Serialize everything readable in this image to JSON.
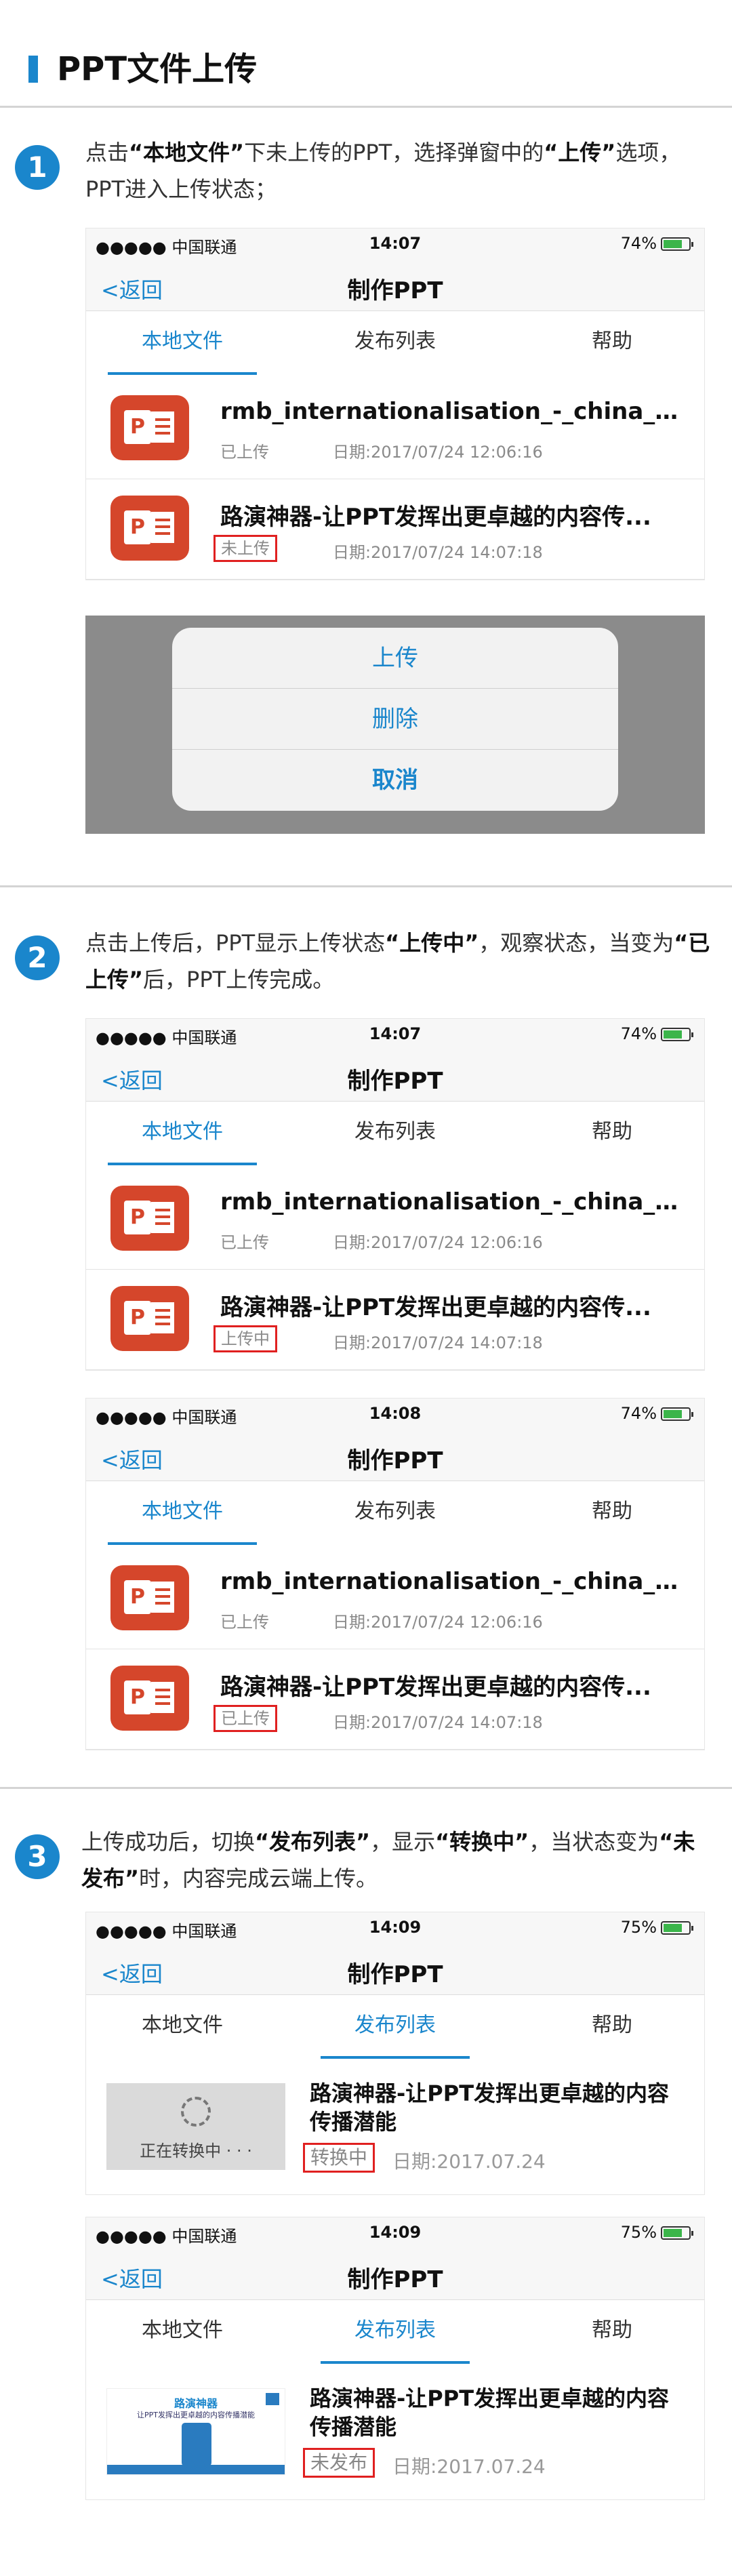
{
  "page": {
    "title": "PPT文件上传"
  },
  "steps": [
    {
      "num": "1",
      "text_parts": [
        "点击",
        "“本地文件”",
        "下未上传的PPT，选择弹窗中的",
        "“上传”",
        "选项，PPT进入上传状态；"
      ]
    },
    {
      "num": "2",
      "text_parts": [
        "点击上传后，PPT显示上传状态",
        "“上传中”",
        "，观察状态，当变为",
        "“已上传”",
        "后，PPT上传完成。"
      ]
    },
    {
      "num": "3",
      "text_parts": [
        "上传成功后，切换",
        "“发布列表”",
        "，显示",
        "“转换中”",
        "，当状态变为",
        "“未发布”",
        "时，内容完成云端上传。"
      ]
    }
  ],
  "colors": {
    "accent": "#1a86cc",
    "highlight_box": "#e02020",
    "ppt_icon": "#d5462b"
  },
  "ui": {
    "carrier": "●●●●● 中国联通",
    "back": "<返回",
    "nav_title": "制作PPT",
    "tabs": [
      "本地文件",
      "发布列表",
      "帮助"
    ]
  },
  "screens": [
    {
      "time": "14:07",
      "battery": "74%",
      "battery_level": 0.74,
      "active_tab": 0,
      "rows": [
        {
          "name": "rmb_internationalisation_-_china_webi...",
          "status": "已上传",
          "date": "日期:2017/07/24 12:06:16",
          "boxed": false
        },
        {
          "name": "路演神器-让PPT发挥出更卓越的内容传...",
          "status": "未上传",
          "date": "日期:2017/07/24 14:07:18",
          "boxed": true
        }
      ]
    },
    {
      "time": "14:07",
      "battery": "74%",
      "battery_level": 0.74,
      "active_tab": 0,
      "rows": [
        {
          "name": "rmb_internationalisation_-_china_webi...",
          "status": "已上传",
          "date": "日期:2017/07/24 12:06:16",
          "boxed": false
        },
        {
          "name": "路演神器-让PPT发挥出更卓越的内容传...",
          "status": "上传中",
          "date": "日期:2017/07/24 14:07:18",
          "boxed": true
        }
      ]
    },
    {
      "time": "14:08",
      "battery": "74%",
      "battery_level": 0.74,
      "active_tab": 0,
      "rows": [
        {
          "name": "rmb_internationalisation_-_china_webi...",
          "status": "已上传",
          "date": "日期:2017/07/24 12:06:16",
          "boxed": false
        },
        {
          "name": "路演神器-让PPT发挥出更卓越的内容传...",
          "status": "已上传",
          "date": "日期:2017/07/24 14:07:18",
          "boxed": true
        }
      ]
    },
    {
      "time": "14:09",
      "battery": "75%",
      "battery_level": 0.75,
      "active_tab": 1,
      "pub": {
        "name": "路演神器-让PPT发挥出更卓越的内容传播潜能",
        "status": "转换中",
        "date": "日期:2017.07.24",
        "thumb_label": "正在转换中 · · ·"
      }
    },
    {
      "time": "14:09",
      "battery": "75%",
      "battery_level": 0.75,
      "active_tab": 1,
      "pub": {
        "name": "路演神器-让PPT发挥出更卓越的内容传播潜能",
        "status": "未发布",
        "date": "日期:2017.07.24",
        "poster_title": "路演神器",
        "poster_sub": "让PPT发挥出更卓越的内容传播潜能"
      }
    }
  ],
  "action_sheet": {
    "items": [
      "上传",
      "删除",
      "取消"
    ]
  }
}
